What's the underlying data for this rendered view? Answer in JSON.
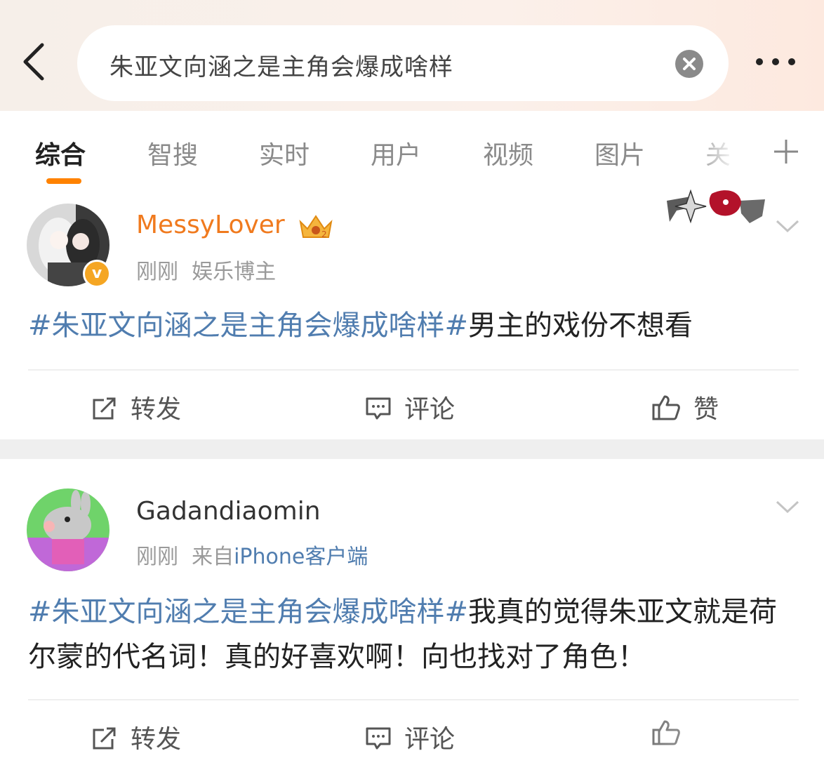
{
  "search": {
    "query": "朱亚文向涵之是主角会爆成啥样"
  },
  "tabs": [
    {
      "label": "综合"
    },
    {
      "label": "智搜"
    },
    {
      "label": "实时"
    },
    {
      "label": "用户"
    },
    {
      "label": "视频"
    },
    {
      "label": "图片"
    },
    {
      "label": "关"
    }
  ],
  "posts": [
    {
      "username": "MessyLover",
      "time": "刚刚",
      "meta_suffix": "娱乐博主",
      "hashtag": "#朱亚文向涵之是主角会爆成啥样#",
      "body": "男主的戏份不想看",
      "actions": {
        "repost": "转发",
        "comment": "评论",
        "like": "赞"
      }
    },
    {
      "username": "Gadandiaomin",
      "time": "刚刚",
      "meta_prefix": "来自",
      "meta_source": "iPhone客户端",
      "hashtag": "#朱亚文向涵之是主角会爆成啥样#",
      "body": "我真的觉得朱亚文就是荷尔蒙的代名词！真的好喜欢啊！向也找对了角色！",
      "actions": {
        "repost": "转发",
        "comment": "评论"
      }
    }
  ],
  "colors": {
    "accent": "#ff8200",
    "link": "#507daf",
    "vip_name": "#f07a1e"
  }
}
